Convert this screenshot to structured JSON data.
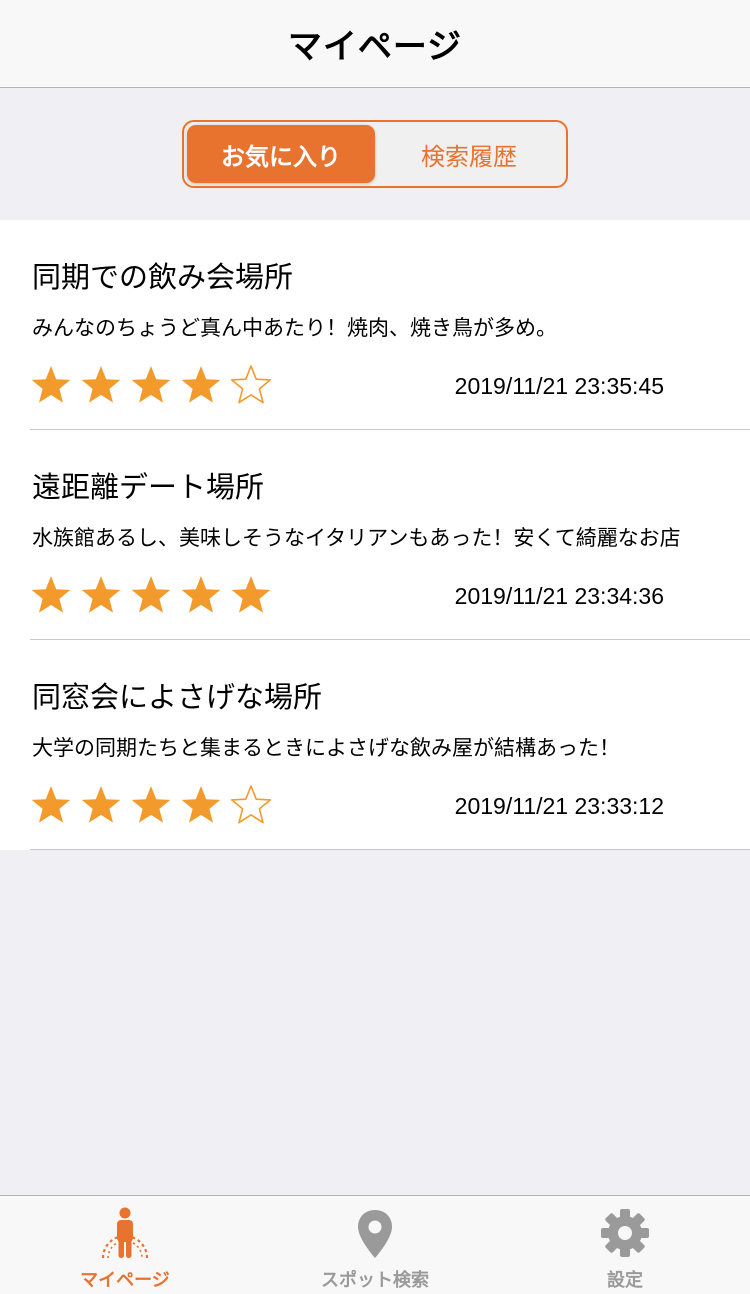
{
  "nav": {
    "title": "マイページ"
  },
  "segment": {
    "options": [
      "お気に入り",
      "検索履歴"
    ],
    "selected": "お気に入り"
  },
  "items": [
    {
      "title": "同期での飲み会場所",
      "desc": "みんなのちょうど真ん中あたり！焼肉、焼き鳥が多め。",
      "rating": 4,
      "max_rating": 5,
      "date": "2019/11/21 23:35:45"
    },
    {
      "title": "遠距離デート場所",
      "desc": "水族館あるし、美味しそうなイタリアンもあった！安くて綺麗なお店",
      "rating": 5,
      "max_rating": 5,
      "date": "2019/11/21 23:34:36"
    },
    {
      "title": "同窓会によさげな場所",
      "desc": "大学の同期たちと集まるときによさげな飲み屋が結構あった！",
      "rating": 4,
      "max_rating": 5,
      "date": "2019/11/21 23:33:12"
    }
  ],
  "tabs": [
    {
      "label": "マイページ",
      "icon": "person-icon",
      "active": true
    },
    {
      "label": "スポット検索",
      "icon": "map-pin-icon",
      "active": false
    },
    {
      "label": "設定",
      "icon": "gear-icon",
      "active": false
    }
  ],
  "colors": {
    "accent": "#e8732e",
    "star": "#f39a2c",
    "inactive": "#9a9a9a"
  }
}
